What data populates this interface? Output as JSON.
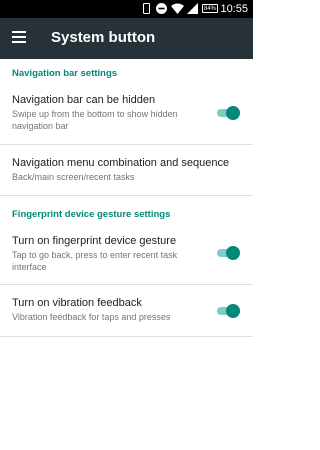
{
  "status_bar": {
    "time": "10:55",
    "battery": "84%",
    "icons": [
      "phone-icon",
      "do-not-disturb-icon",
      "wifi-icon",
      "signal-icon",
      "battery-icon"
    ]
  },
  "app_bar": {
    "title": "System button",
    "menu_icon": "hamburger-menu-icon"
  },
  "sections": {
    "navigation": {
      "header": "Navigation bar settings",
      "hidden": {
        "title": "Navigation bar can be hidden",
        "subtitle": "Swipe up from the bottom to show hidden navigation bar",
        "enabled": true
      },
      "combination": {
        "title": "Navigation menu combination and sequence",
        "subtitle": "Back/main screen/recent tasks"
      }
    },
    "fingerprint": {
      "header": "Fingerprint device gesture settings",
      "gesture": {
        "title": "Turn on fingerprint device gesture",
        "subtitle": "Tap to go back, press to enter recent task interface",
        "enabled": true
      },
      "vibration": {
        "title": "Turn on vibration feedback",
        "subtitle": "Vibration feedback for taps and presses",
        "enabled": true
      }
    }
  },
  "colors": {
    "accent": "#00897B",
    "toggle_track": "#80CBC4",
    "app_bar": "#263238",
    "status_bar": "#000000"
  }
}
